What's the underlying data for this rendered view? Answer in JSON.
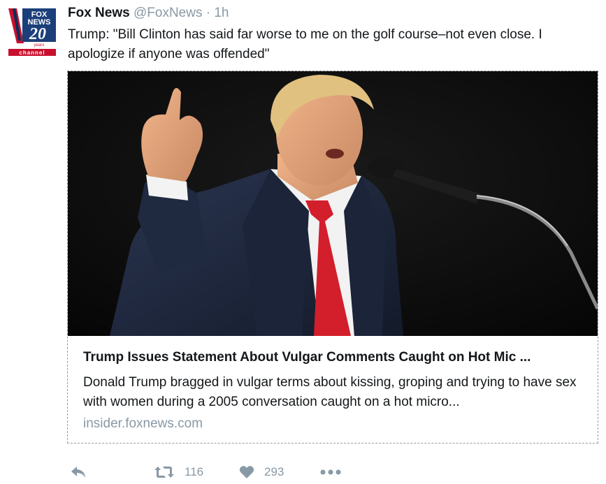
{
  "tweet": {
    "author_name": "Fox News",
    "handle": "@FoxNews",
    "separator": "·",
    "time": "1h",
    "text": "Trump: \"Bill Clinton has said far worse to me on the golf course–not even close. I apologize if anyone was offended\""
  },
  "avatar": {
    "logo_lines": [
      "FOX",
      "NEWS",
      "20",
      "years",
      "channel"
    ]
  },
  "card": {
    "image_alt": "Donald Trump speaking at a microphone with raised hand",
    "title": "Trump Issues Statement About Vulgar Comments Caught on Hot Mic ...",
    "description": "Donald Trump bragged in vulgar terms about kissing, groping and trying to have sex with women during a 2005 conversation caught on a hot micro...",
    "domain": "insider.foxnews.com"
  },
  "actions": {
    "reply_icon": "reply-icon",
    "retweet_icon": "retweet-icon",
    "retweet_count": "116",
    "like_icon": "heart-icon",
    "like_count": "293",
    "more_icon": "more-icon"
  },
  "colors": {
    "fox_red": "#c8102e",
    "fox_blue": "#00305a",
    "muted": "#8899a6",
    "text": "#14171a"
  }
}
